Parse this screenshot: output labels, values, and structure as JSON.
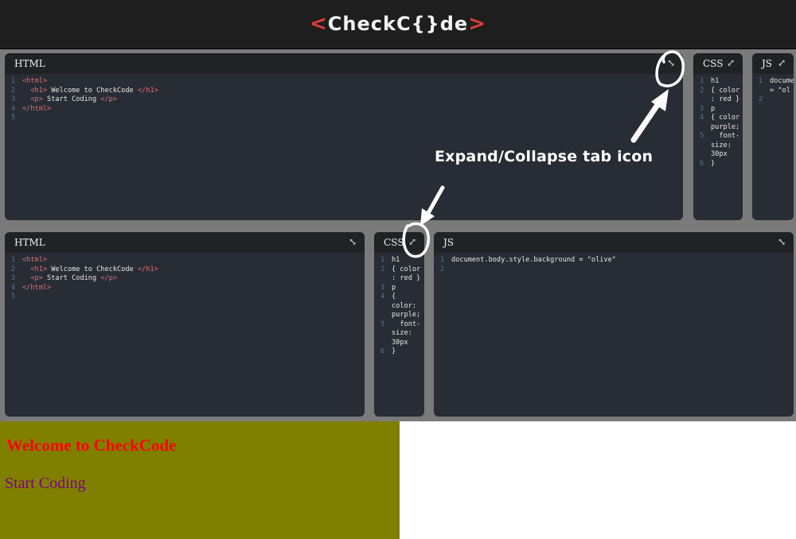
{
  "app": {
    "logo_left": "<",
    "logo_text": "CheckC{}de",
    "logo_right": ">"
  },
  "top_row": {
    "html_title": "HTML",
    "css_title": "CSS",
    "js_title": "JS",
    "html_lines": [
      {
        "n": "1",
        "parts": [
          {
            "t": "<html>",
            "c": "tag"
          }
        ]
      },
      {
        "n": "2",
        "parts": [
          {
            "t": "  <h1>",
            "c": "tag"
          },
          {
            "t": " Welcome to CheckCode ",
            "c": "plain"
          },
          {
            "t": "</h1>",
            "c": "tag"
          }
        ]
      },
      {
        "n": "3",
        "parts": [
          {
            "t": "  <p>",
            "c": "tag"
          },
          {
            "t": " Start Coding ",
            "c": "plain"
          },
          {
            "t": "</p>",
            "c": "tag"
          }
        ]
      },
      {
        "n": "4",
        "parts": [
          {
            "t": "</html>",
            "c": "tag"
          }
        ]
      },
      {
        "n": "5",
        "parts": []
      }
    ],
    "css_lines": [
      {
        "n": "1",
        "parts": [
          {
            "t": "h1",
            "c": "plain"
          }
        ]
      },
      {
        "n": "2",
        "parts": [
          {
            "t": "{ color",
            "c": "plain"
          }
        ]
      },
      {
        "n": "",
        "parts": [
          {
            "t": ": red }",
            "c": "plain"
          }
        ]
      },
      {
        "n": "3",
        "parts": [
          {
            "t": "p",
            "c": "plain"
          }
        ]
      },
      {
        "n": "4",
        "parts": [
          {
            "t": "{ color",
            "c": "plain"
          }
        ]
      },
      {
        "n": "",
        "parts": [
          {
            "t": "purple;",
            "c": "plain"
          }
        ]
      },
      {
        "n": "5",
        "parts": [
          {
            "t": "  font-",
            "c": "plain"
          }
        ]
      },
      {
        "n": "",
        "parts": [
          {
            "t": "size:",
            "c": "plain"
          }
        ]
      },
      {
        "n": "",
        "parts": [
          {
            "t": "30px",
            "c": "plain"
          }
        ]
      },
      {
        "n": "6",
        "parts": [
          {
            "t": "}",
            "c": "plain"
          }
        ]
      }
    ],
    "js_lines": [
      {
        "n": "1",
        "parts": [
          {
            "t": "docume",
            "c": "plain"
          }
        ]
      },
      {
        "n": "",
        "parts": [
          {
            "t": "= \"ol",
            "c": "plain"
          }
        ]
      },
      {
        "n": "2",
        "parts": []
      }
    ]
  },
  "bottom_row": {
    "html_title": "HTML",
    "css_title": "CSS",
    "js_title": "JS",
    "html_lines": [
      {
        "n": "1",
        "parts": [
          {
            "t": "<html>",
            "c": "tag"
          }
        ]
      },
      {
        "n": "2",
        "parts": [
          {
            "t": "  <h1>",
            "c": "tag"
          },
          {
            "t": " Welcome to CheckCode ",
            "c": "plain"
          },
          {
            "t": "</h1>",
            "c": "tag"
          }
        ]
      },
      {
        "n": "3",
        "parts": [
          {
            "t": "  <p>",
            "c": "tag"
          },
          {
            "t": " Start Coding ",
            "c": "plain"
          },
          {
            "t": "</p>",
            "c": "tag"
          }
        ]
      },
      {
        "n": "4",
        "parts": [
          {
            "t": "</html>",
            "c": "tag"
          }
        ]
      },
      {
        "n": "5",
        "parts": []
      }
    ],
    "css_lines": [
      {
        "n": "1",
        "parts": [
          {
            "t": "h1",
            "c": "plain"
          }
        ]
      },
      {
        "n": "2",
        "parts": [
          {
            "t": "{ color",
            "c": "plain"
          }
        ]
      },
      {
        "n": "",
        "parts": [
          {
            "t": ": red }",
            "c": "plain"
          }
        ]
      },
      {
        "n": "3",
        "parts": [
          {
            "t": "p",
            "c": "plain"
          }
        ]
      },
      {
        "n": "4",
        "parts": [
          {
            "t": "{",
            "c": "plain"
          }
        ]
      },
      {
        "n": "",
        "parts": [
          {
            "t": "color:",
            "c": "plain"
          }
        ]
      },
      {
        "n": "",
        "parts": [
          {
            "t": "purple;",
            "c": "plain"
          }
        ]
      },
      {
        "n": "5",
        "parts": [
          {
            "t": "  font-",
            "c": "plain"
          }
        ]
      },
      {
        "n": "",
        "parts": [
          {
            "t": "size:",
            "c": "plain"
          }
        ]
      },
      {
        "n": "",
        "parts": [
          {
            "t": "30px",
            "c": "plain"
          }
        ]
      },
      {
        "n": "6",
        "parts": [
          {
            "t": "}",
            "c": "plain"
          }
        ]
      }
    ],
    "js_lines": [
      {
        "n": "1",
        "parts": [
          {
            "t": "document.body.style.background = \"olive\"",
            "c": "plain"
          }
        ]
      },
      {
        "n": "2",
        "parts": []
      }
    ]
  },
  "annotation": {
    "label": "Expand/Collapse tab icon"
  },
  "preview": {
    "heading": "Welcome to CheckCode",
    "paragraph": "Start Coding",
    "background_color": "#808000"
  },
  "icons": {
    "expand": "expand-icon",
    "collapse": "collapse-icon"
  },
  "colors": {
    "logo_accent": "#e23b3b",
    "editor_bg": "#282c34",
    "tag": "#e06c75",
    "preview_heading": "#ff0000",
    "preview_paragraph": "#800080"
  }
}
